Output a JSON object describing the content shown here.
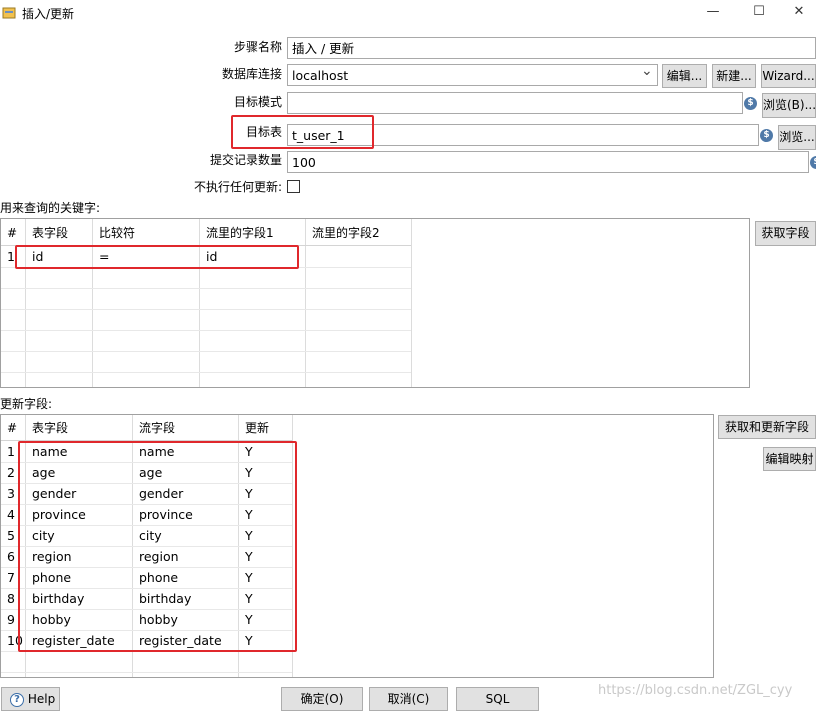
{
  "window": {
    "title": "插入/更新",
    "minimize_glyph": "—",
    "maximize_glyph": "☐",
    "close_glyph": "✕"
  },
  "form": {
    "step_name_label": "步骤名称",
    "step_name_value": "插入 / 更新",
    "connection_label": "数据库连接",
    "connection_value": "localhost",
    "edit_button": "编辑...",
    "new_button": "新建...",
    "wizard_button": "Wizard...",
    "schema_label": "目标模式",
    "schema_value": "",
    "browse_b_button": "浏览(B)...",
    "table_label": "目标表",
    "table_value": "t_user_1",
    "browse_button": "浏览...",
    "commit_label": "提交记录数量",
    "commit_value": "100",
    "no_update_label": "不执行任何更新:"
  },
  "keys_section": {
    "label": "用来查询的关键字:",
    "get_fields_button": "获取字段",
    "headers": [
      "#",
      "表字段",
      "比较符",
      "流里的字段1",
      "流里的字段2"
    ],
    "rows": [
      {
        "num": "1",
        "table_field": "id",
        "comparator": "=",
        "stream_field1": "id",
        "stream_field2": ""
      }
    ]
  },
  "update_section": {
    "label": "更新字段:",
    "get_update_button": "获取和更新字段",
    "edit_mapping_button": "编辑映射",
    "headers": [
      "#",
      "表字段",
      "流字段",
      "更新"
    ],
    "rows": [
      {
        "num": "1",
        "table_field": "name",
        "stream_field": "name",
        "update": "Y"
      },
      {
        "num": "2",
        "table_field": "age",
        "stream_field": "age",
        "update": "Y"
      },
      {
        "num": "3",
        "table_field": "gender",
        "stream_field": "gender",
        "update": "Y"
      },
      {
        "num": "4",
        "table_field": "province",
        "stream_field": "province",
        "update": "Y"
      },
      {
        "num": "5",
        "table_field": "city",
        "stream_field": "city",
        "update": "Y"
      },
      {
        "num": "6",
        "table_field": "region",
        "stream_field": "region",
        "update": "Y"
      },
      {
        "num": "7",
        "table_field": "phone",
        "stream_field": "phone",
        "update": "Y"
      },
      {
        "num": "8",
        "table_field": "birthday",
        "stream_field": "birthday",
        "update": "Y"
      },
      {
        "num": "9",
        "table_field": "hobby",
        "stream_field": "hobby",
        "update": "Y"
      },
      {
        "num": "10",
        "table_field": "register_date",
        "stream_field": "register_date",
        "update": "Y"
      }
    ]
  },
  "footer": {
    "help_button": "Help",
    "ok_button": "确定(O)",
    "cancel_button": "取消(C)",
    "sql_button": "SQL",
    "watermark": "https://blog.csdn.net/ZGL_cyy"
  },
  "icons": {
    "variable_glyph": "$",
    "dropdown_glyph": "⌄",
    "help_glyph": "?"
  },
  "colors": {
    "highlight_red": "#e0282c",
    "button_face": "#e1e1e1",
    "variable_icon_blue": "#4f79a8"
  }
}
